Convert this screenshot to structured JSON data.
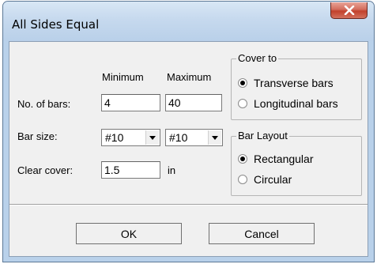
{
  "window": {
    "title": "All Sides Equal"
  },
  "colheaders": {
    "minimum": "Minimum",
    "maximum": "Maximum"
  },
  "bars": {
    "label": "No. of bars:",
    "min": "4",
    "max": "40"
  },
  "barsize": {
    "label": "Bar size:",
    "min": "#10",
    "max": "#10"
  },
  "cover": {
    "label": "Clear cover:",
    "value": "1.5",
    "unit": "in"
  },
  "cover_to": {
    "title": "Cover to",
    "options": [
      {
        "label": "Transverse bars",
        "checked": true
      },
      {
        "label": "Longitudinal bars",
        "checked": false
      }
    ]
  },
  "layout": {
    "title": "Bar Layout",
    "options": [
      {
        "label": "Rectangular",
        "checked": true
      },
      {
        "label": "Circular",
        "checked": false
      }
    ]
  },
  "buttons": {
    "ok": "OK",
    "cancel": "Cancel"
  }
}
